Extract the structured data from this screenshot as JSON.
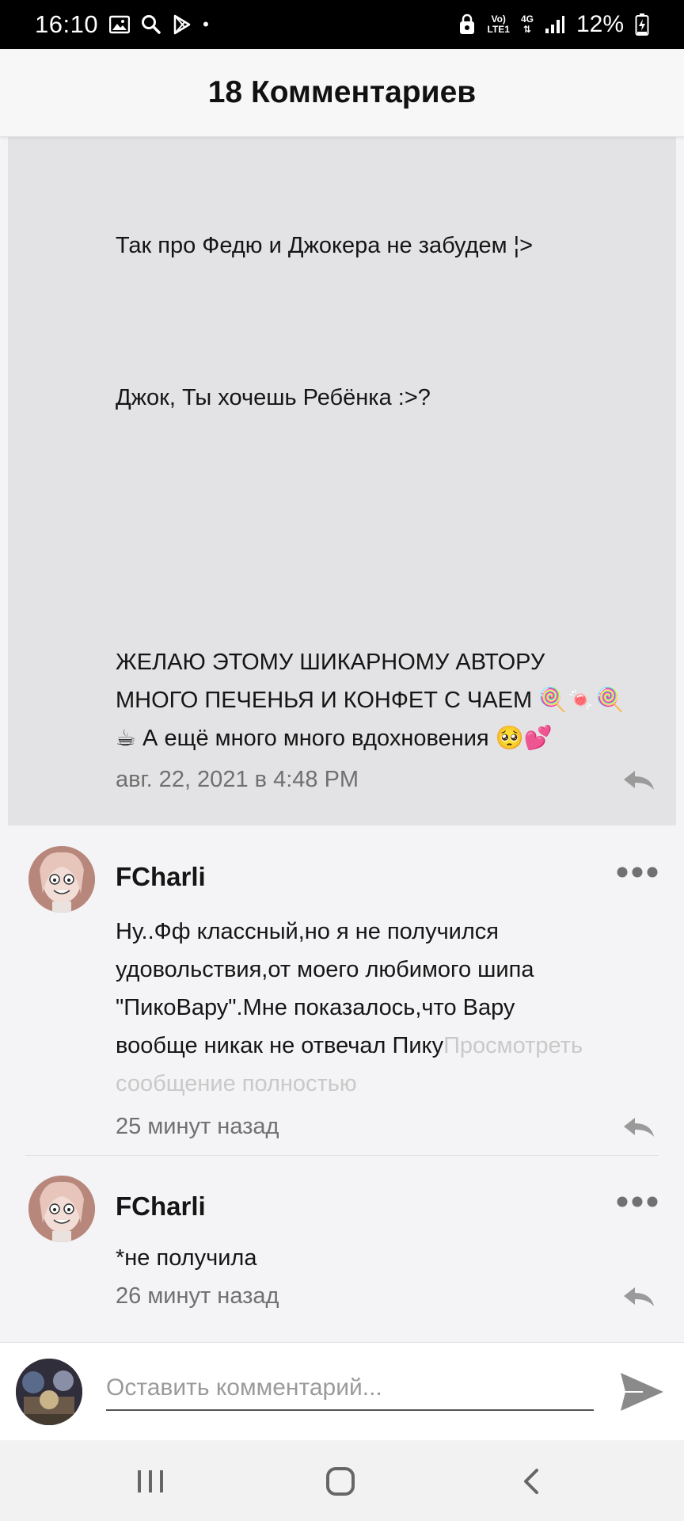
{
  "status_bar": {
    "time": "16:10",
    "battery": "12%",
    "network_top": "Vo)",
    "network_bottom": "LTE1",
    "signal_gen": "4G",
    "icons": [
      "gallery-icon",
      "search-icon",
      "play-store-icon",
      "notification-dot",
      "alarm-lock-icon",
      "signal-icon",
      "battery-charging-icon"
    ]
  },
  "header": {
    "title": "18 Комментариев"
  },
  "highlight_comment": {
    "lines": [
      "Так про Федю и Джокера не забудем ¦>",
      "Джок, Ты хочешь Ребёнка :>?",
      "ЖЕЛАЮ ЭТОМУ ШИКАРНОМУ АВТОРУ",
      "МНОГО ПЕЧЕНЬЯ И КОНФЕТ С ЧАЕМ 🍭🍬🍭",
      "☕ А ещё много много вдохновения 🥺💕"
    ],
    "timestamp": "авг. 22, 2021 в 4:48 PM"
  },
  "comments": [
    {
      "author": "FCharli",
      "lines": [
        "Ну..Фф классный,но я не получился",
        "удовольствия,от моего любимого шипа",
        "\"ПикоВару\".Мне показалось,что Вару",
        "вообще никак не отвечал Пику"
      ],
      "read_more_1": "Просмотреть",
      "read_more_2": "сообщение полностью",
      "timestamp": "25 минут назад"
    },
    {
      "author": "FCharli",
      "lines": [
        "*не получила"
      ],
      "timestamp": "26 минут назад"
    }
  ],
  "input": {
    "placeholder": "Оставить комментарий..."
  },
  "colors": {
    "accent_icon": "#9a9a9a",
    "highlight_bg": "#e3e2e4",
    "send_icon": "#8a8a8a"
  }
}
